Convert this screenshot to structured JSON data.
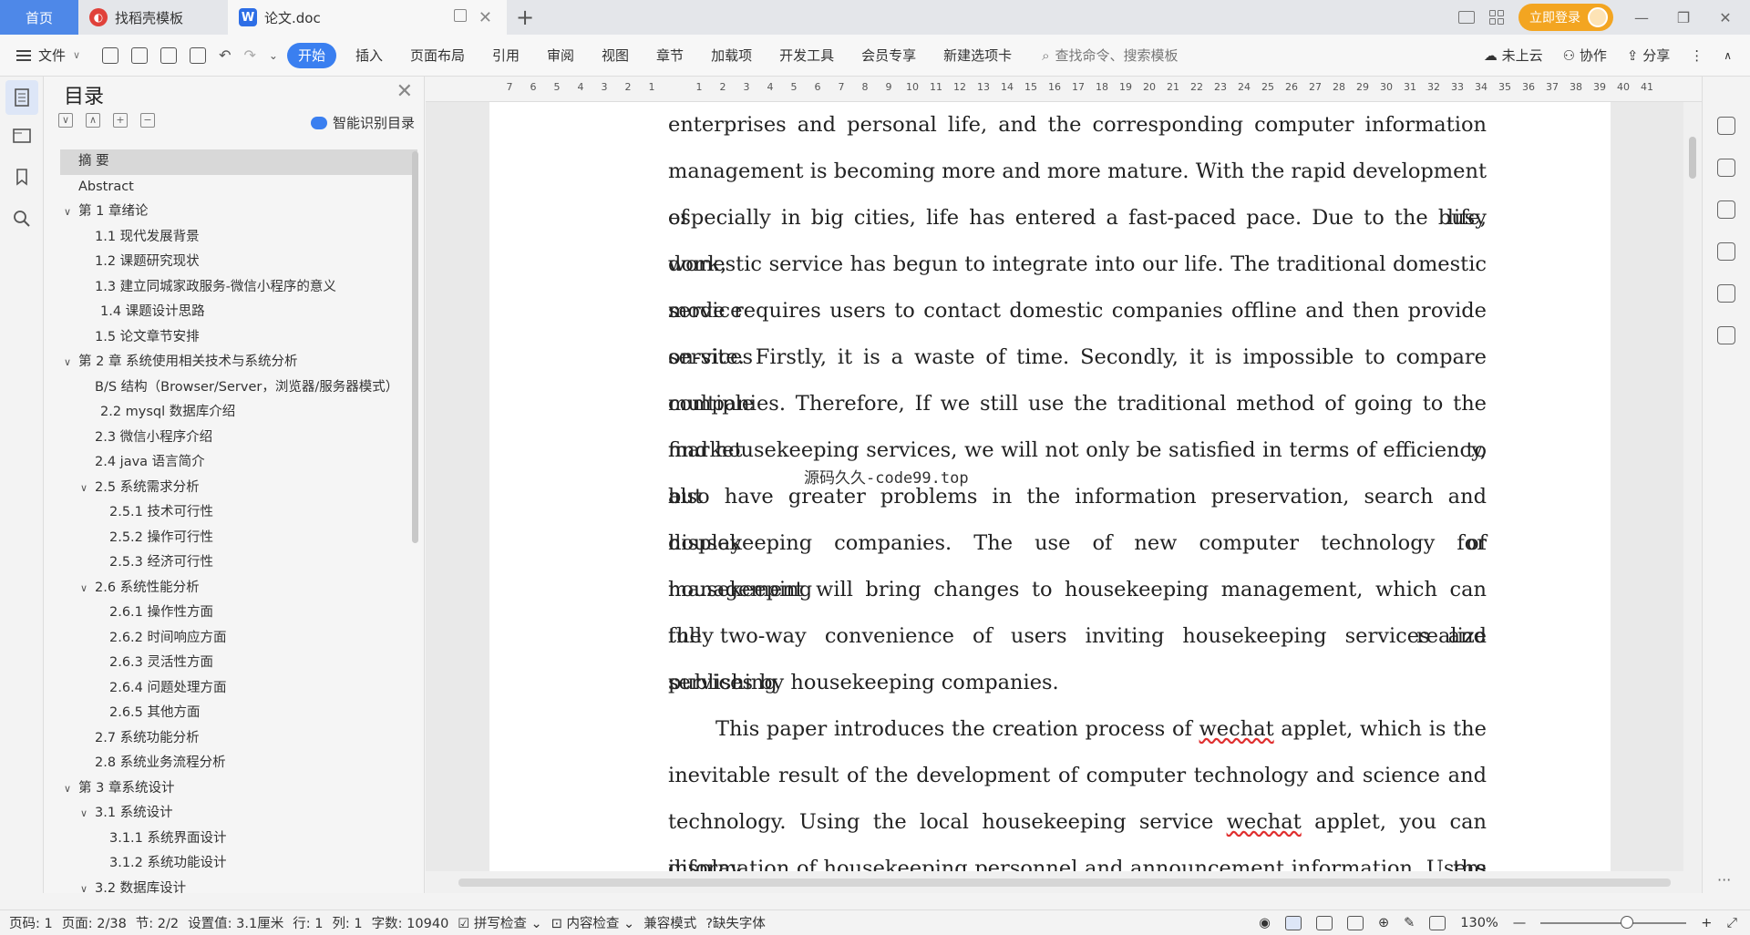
{
  "titlebar": {
    "tabs": [
      {
        "label": "首页"
      },
      {
        "label": "找稻壳模板"
      },
      {
        "label": "论文.doc"
      }
    ],
    "login_label": "立即登录"
  },
  "menubar": {
    "file_label": "文件",
    "ribbon_tabs": [
      "开始",
      "插入",
      "页面布局",
      "引用",
      "审阅",
      "视图",
      "章节",
      "加载项",
      "开发工具",
      "会员专享",
      "新建选项卡"
    ],
    "search_placeholder": "查找命令、搜索模板",
    "cloud_label": "未上云",
    "collab_label": "协作",
    "share_label": "分享"
  },
  "toc": {
    "title": "目录",
    "smart_label": "智能识别目录",
    "items": [
      {
        "text": "摘  要",
        "level": 0,
        "selected": true
      },
      {
        "text": "Abstract",
        "level": 0
      },
      {
        "text": "第 1 章绪论",
        "level": 0,
        "expand": true
      },
      {
        "text": "1.1  现代发展背景",
        "level": 1
      },
      {
        "text": "1.2  课题研究现状",
        "level": 1
      },
      {
        "text": "1.3  建立同城家政服务-微信小程序的意义",
        "level": 1
      },
      {
        "text": "1.4  课题设计思路",
        "level": 1.4
      },
      {
        "text": "1.5  论文章节安排",
        "level": 1
      },
      {
        "text": "第 2 章  系统使用相关技术与系统分析",
        "level": 0,
        "expand": true
      },
      {
        "text": "B/S 结构（Browser/Server，浏览器/服务器模式）",
        "level": 1
      },
      {
        "text": "2.2 mysql 数据库介绍",
        "level": 1.4
      },
      {
        "text": "2.3  微信小程序介绍",
        "level": 1
      },
      {
        "text": "2.4 java 语言简介",
        "level": 1
      },
      {
        "text": "2.5 系统需求分析",
        "level": 1,
        "expand": true
      },
      {
        "text": "2.5.1  技术可行性",
        "level": 2
      },
      {
        "text": "2.5.2  操作可行性",
        "level": 2
      },
      {
        "text": "2.5.3 经济可行性",
        "level": 2
      },
      {
        "text": "2.6  系统性能分析",
        "level": 1,
        "expand": true
      },
      {
        "text": "2.6.1 操作性方面",
        "level": 2
      },
      {
        "text": "2.6.2  时间响应方面",
        "level": 2
      },
      {
        "text": "2.6.3 灵活性方面",
        "level": 2
      },
      {
        "text": "2.6.4 问题处理方面",
        "level": 2
      },
      {
        "text": "2.6.5 其他方面",
        "level": 2
      },
      {
        "text": "2.7 系统功能分析",
        "level": 1
      },
      {
        "text": "2.8 系统业务流程分析",
        "level": 1
      },
      {
        "text": "第 3 章系统设计",
        "level": 0,
        "expand": true
      },
      {
        "text": "3.1  系统设计",
        "level": 1,
        "expand": true
      },
      {
        "text": "3.1.1 系统界面设计",
        "level": 2
      },
      {
        "text": "3.1.2 系统功能设计",
        "level": 2
      },
      {
        "text": "3.2  数据库设计",
        "level": 1,
        "expand": true
      }
    ]
  },
  "ruler": {
    "numbers": [
      "7",
      "6",
      "5",
      "4",
      "3",
      "2",
      "1",
      "",
      "1",
      "2",
      "3",
      "4",
      "5",
      "6",
      "7",
      "8",
      "9",
      "10",
      "11",
      "12",
      "13",
      "14",
      "15",
      "16",
      "17",
      "18",
      "19",
      "20",
      "21",
      "22",
      "23",
      "24",
      "25",
      "26",
      "27",
      "28",
      "29",
      "30",
      "31",
      "32",
      "33",
      "34",
      "35",
      "36",
      "37",
      "38",
      "39",
      "40",
      "41"
    ]
  },
  "document": {
    "para1": [
      "enterprises and personal life, and the corresponding computer information",
      "management is becoming more and more mature. With the rapid development of life,",
      "especially in big cities, life has entered a fast-paced pace. Due to the busy work,",
      "domestic service has begun to integrate into our life. The traditional domestic service",
      "mode requires users to contact domestic companies offline and then provide services",
      "on-site. Firstly, it is a waste of time. Secondly, it is impossible to compare multiple",
      "companies. Therefore, If we still use the traditional method of going to the market to",
      "find housekeeping services, we will not only be satisfied in terms of efficiency, but",
      "also have greater problems in the information preservation, search and display of",
      "housekeeping companies. The use of new computer technology for housekeeping",
      "management will bring changes to housekeeping management, which can fully realize",
      "the two-way convenience of users inviting housekeeping services and publishing",
      "services by housekeeping companies."
    ],
    "para2": {
      "l1a": "This paper introduces the creation process of ",
      "l1u": "wechat",
      "l1b": " applet, which is the",
      "l2": "inevitable result of the development of computer technology and science and",
      "l3a": "technology. Using the local housekeeping service ",
      "l3u": "wechat",
      "l3b": " applet, you can display the",
      "l4": "information of housekeeping personnel and announcement information. Users can"
    },
    "watermark": "源码久久-code99.top"
  },
  "status": {
    "page_code": "页码: 1",
    "page": "页面: 2/38",
    "section": "节: 2/2",
    "setting": "设置值: 3.1厘米",
    "row": "行: 1",
    "col": "列: 1",
    "words": "字数: 10940",
    "spell": "拼写检查",
    "content": "内容检查",
    "compat": "兼容模式",
    "missing_font": "缺失字体",
    "zoom": "130%"
  },
  "colors": {
    "accent": "#3a7ff0",
    "home_tab": "#4e88e8",
    "login": "#f3a521"
  }
}
